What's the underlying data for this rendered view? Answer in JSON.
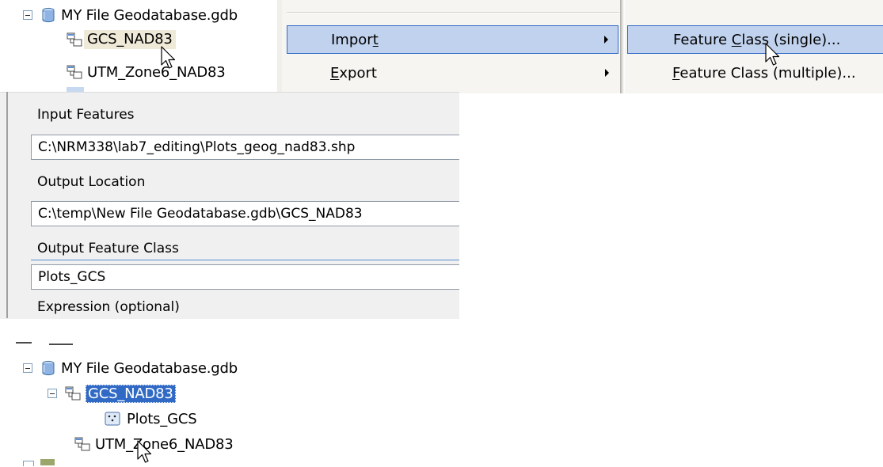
{
  "top_tree": {
    "gdb_label": "MY File Geodatabase.gdb",
    "items": [
      {
        "label": "GCS_NAD83"
      },
      {
        "label": "UTM_Zone6_NAD83"
      }
    ]
  },
  "context_menu": {
    "items": [
      {
        "before": "Impor",
        "accel": "t",
        "after": ""
      },
      {
        "before": "",
        "accel": "E",
        "after": "xport"
      }
    ]
  },
  "submenu": {
    "items": [
      {
        "before": "Feature ",
        "accel": "C",
        "after": "lass (single)..."
      },
      {
        "before": "",
        "accel": "F",
        "after": "eature Class (multiple)..."
      }
    ]
  },
  "dialog": {
    "fields": [
      {
        "label": "Input Features",
        "value": "C:\\NRM338\\lab7_editing\\Plots_geog_nad83.shp"
      },
      {
        "label": "Output Location",
        "value": "C:\\temp\\New File Geodatabase.gdb\\GCS_NAD83"
      },
      {
        "label": "Output Feature Class",
        "value": "Plots_GCS"
      }
    ],
    "expression_label": "Expression (optional)"
  },
  "bottom_tree": {
    "gdb_label": "MY File Geodatabase.gdb",
    "dataset_label": "GCS_NAD83",
    "feature_class_label": "Plots_GCS",
    "utm_label": "UTM_Zone6_NAD83"
  },
  "icons": {
    "database": "geodatabase-icon",
    "dataset": "feature-dataset-icon",
    "feature_class": "point-feature-class-icon",
    "cursor": "mouse-pointer-icon"
  },
  "colors": {
    "menu_highlight": "#c1d2ee",
    "menu_highlight_border": "#316ac5",
    "tree_selection": "#316ac5",
    "hover": "#efe9d8",
    "dialog_bg": "#f0f0f0"
  }
}
